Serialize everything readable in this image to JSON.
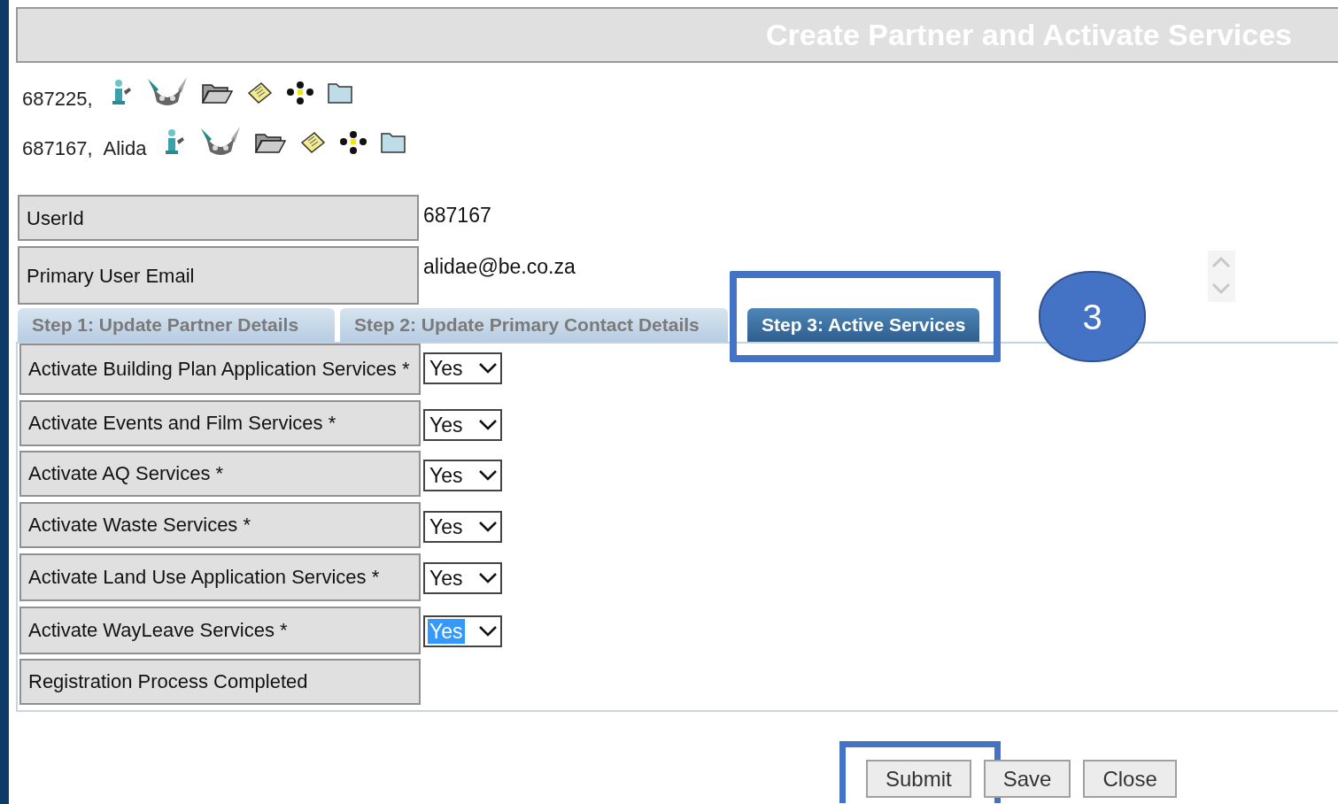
{
  "window": {
    "title": "Create Partner and Activate Services"
  },
  "partners": [
    {
      "id": "687225,"
    },
    {
      "id": "687167,",
      "name": "Alida"
    }
  ],
  "fields": [
    {
      "label": "UserId",
      "value": "687167"
    },
    {
      "label": "Primary User Email",
      "value": "alidae@be.co.za"
    }
  ],
  "tabs": [
    {
      "label": "Step 1: Update Partner Details",
      "selected": false,
      "highlighted": false
    },
    {
      "label": "Step 2: Update Primary Contact Details",
      "selected": false,
      "highlighted": false
    },
    {
      "label": "Step 3: Active Services",
      "selected": true,
      "highlighted": true
    }
  ],
  "step_badge": "3",
  "services": [
    {
      "kind": "select",
      "label": "Activate Building Plan Application Services *",
      "value": "Yes",
      "focused": false
    },
    {
      "kind": "select",
      "label": "Activate Events and Film Services *",
      "value": "Yes",
      "focused": false
    },
    {
      "kind": "select",
      "label": "Activate AQ Services *",
      "value": "Yes",
      "focused": false
    },
    {
      "kind": "select",
      "label": "Activate Waste Services *",
      "value": "Yes",
      "focused": false
    },
    {
      "kind": "select",
      "label": "Activate Land Use Application Services *",
      "value": "Yes",
      "focused": false
    },
    {
      "kind": "select",
      "label": "Activate WayLeave Services *",
      "value": "Yes",
      "focused": true
    },
    {
      "kind": "label",
      "label": "Registration Process Completed"
    }
  ],
  "buttons": [
    {
      "label": "Submit",
      "highlighted": true
    },
    {
      "label": "Save",
      "highlighted": false
    },
    {
      "label": "Close",
      "highlighted": false
    }
  ]
}
